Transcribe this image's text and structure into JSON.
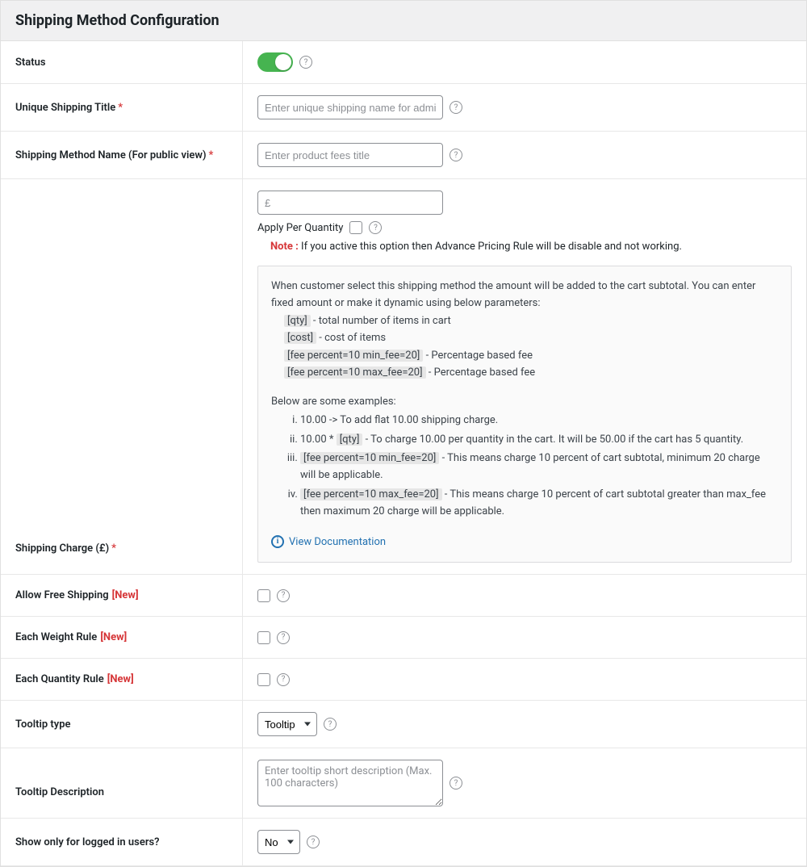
{
  "header": {
    "title": "Shipping Method Configuration"
  },
  "rows": {
    "status": {
      "label": "Status"
    },
    "unique_title": {
      "label": "Unique Shipping Title",
      "required": "*",
      "placeholder": "Enter unique shipping name for admin purpose"
    },
    "method_name": {
      "label": "Shipping Method Name (For public view)",
      "required": "*",
      "placeholder": "Enter product fees title"
    },
    "shipping_charge": {
      "label": "Shipping Charge (£)",
      "required": "*",
      "currency_placeholder": "£",
      "apply_per_qty": "Apply Per Quantity",
      "note_label": "Note :",
      "note_text": " If you active this option then Advance Pricing Rule will be disable and not working.",
      "info_intro": "When customer select this shipping method the amount will be added to the cart subtotal. You can enter fixed amount or make it dynamic using below parameters:",
      "param_qty_tag": "[qty]",
      "param_qty_desc": " - total number of items in cart",
      "param_cost_tag": "[cost]",
      "param_cost_desc": " - cost of items",
      "param_fee_min_tag": "[fee percent=10 min_fee=20]",
      "param_fee_min_desc": " - Percentage based fee",
      "param_fee_max_tag": "[fee percent=10 max_fee=20]",
      "param_fee_max_desc": " - Percentage based fee",
      "examples_heading": "Below are some examples:",
      "ex1": "10.00 -> To add flat 10.00 shipping charge.",
      "ex2_pre": "10.00 * ",
      "ex2_tag": "[qty]",
      "ex2_post": " - To charge 10.00 per quantity in the cart. It will be 50.00 if the cart has 5 quantity.",
      "ex3_tag": "[fee percent=10 min_fee=20]",
      "ex3_post": " - This means charge 10 percent of cart subtotal, minimum 20 charge will be applicable.",
      "ex4_tag": "[fee percent=10 max_fee=20]",
      "ex4_post": " - This means charge 10 percent of cart subtotal greater than max_fee then maximum 20 charge will be applicable.",
      "doc_link": "View Documentation"
    },
    "allow_free": {
      "label": "Allow Free Shipping",
      "new": "[New]"
    },
    "each_weight": {
      "label": "Each Weight Rule",
      "new": "[New]"
    },
    "each_qty": {
      "label": "Each Quantity Rule",
      "new": "[New]"
    },
    "tooltip_type": {
      "label": "Tooltip type",
      "selected": "Tooltip"
    },
    "tooltip_desc": {
      "label": "Tooltip Description",
      "placeholder": "Enter tooltip short description (Max. 100 characters)"
    },
    "logged_in": {
      "label": "Show only for logged in users?",
      "selected": "No"
    }
  }
}
